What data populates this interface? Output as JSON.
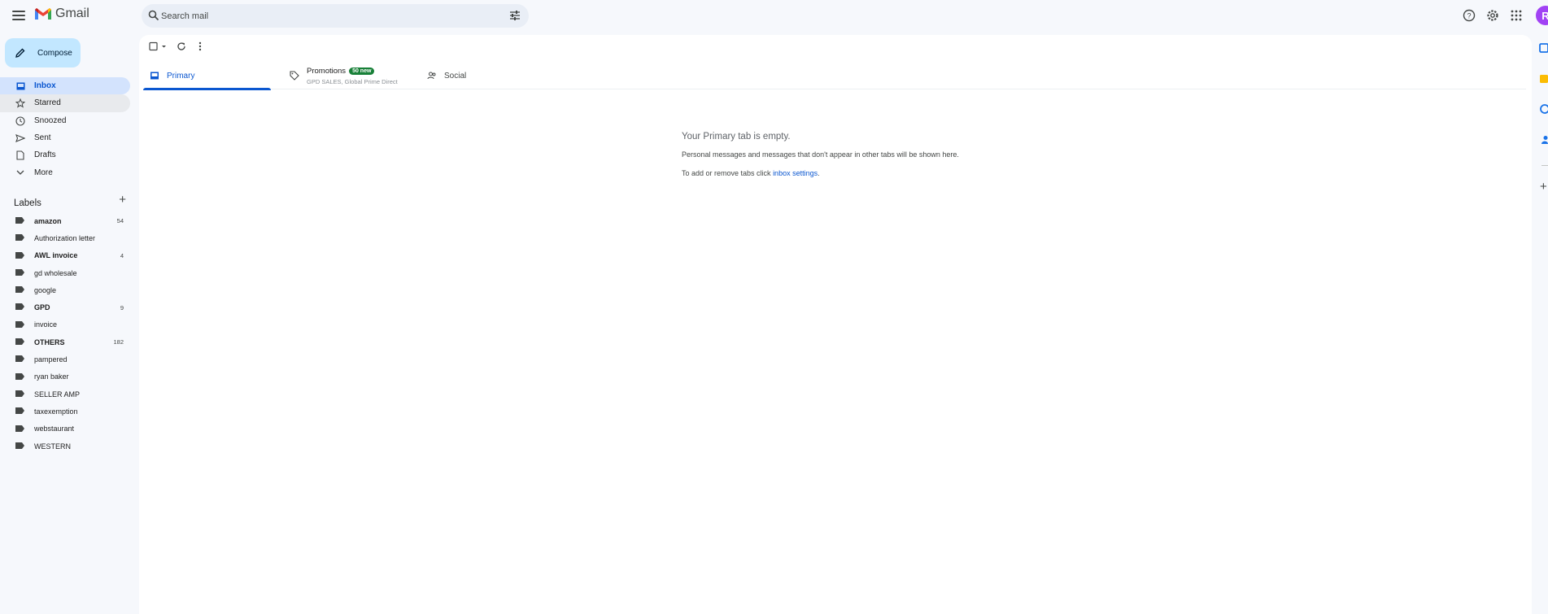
{
  "app": {
    "name": "Gmail",
    "avatar_letter": "R"
  },
  "search": {
    "placeholder": "Search mail"
  },
  "compose": {
    "label": "Compose"
  },
  "nav": [
    {
      "label": "Inbox",
      "icon": "inbox-icon",
      "active": true
    },
    {
      "label": "Starred",
      "icon": "star-icon"
    },
    {
      "label": "Snoozed",
      "icon": "clock-icon"
    },
    {
      "label": "Sent",
      "icon": "send-icon"
    },
    {
      "label": "Drafts",
      "icon": "draft-icon"
    },
    {
      "label": "More",
      "icon": "chevron-down-icon"
    }
  ],
  "labels": {
    "heading": "Labels",
    "items": [
      {
        "name": "amazon",
        "count": "54",
        "bold": true
      },
      {
        "name": "Authorization letter",
        "count": "",
        "bold": false
      },
      {
        "name": "AWL invoice",
        "count": "4",
        "bold": true
      },
      {
        "name": "gd wholesale",
        "count": "",
        "bold": false
      },
      {
        "name": "google",
        "count": "",
        "bold": false
      },
      {
        "name": "GPD",
        "count": "9",
        "bold": true
      },
      {
        "name": "invoice",
        "count": "",
        "bold": false
      },
      {
        "name": "OTHERS",
        "count": "182",
        "bold": true
      },
      {
        "name": "pampered",
        "count": "",
        "bold": false
      },
      {
        "name": "ryan baker",
        "count": "",
        "bold": false
      },
      {
        "name": "SELLER AMP",
        "count": "",
        "bold": false
      },
      {
        "name": "taxexemption",
        "count": "",
        "bold": false
      },
      {
        "name": "webstaurant",
        "count": "",
        "bold": false
      },
      {
        "name": "WESTERN",
        "count": "",
        "bold": false
      }
    ]
  },
  "tabs": {
    "primary": "Primary",
    "promotions": "Promotions",
    "promotions_badge": "50 new",
    "promotions_senders": "GPD SALES, Global Prime Direct",
    "social": "Social"
  },
  "empty_state": {
    "title": "Your Primary tab is empty.",
    "description": "Personal messages and messages that don't appear in other tabs will be shown here.",
    "hint_prefix": "To add or remove tabs click ",
    "hint_link": "inbox settings",
    "hint_suffix": "."
  },
  "colors": {
    "accent": "#0b57d0",
    "compose_bg": "#c2e7ff",
    "badge_green": "#188038",
    "avatar": "#a142f4"
  }
}
